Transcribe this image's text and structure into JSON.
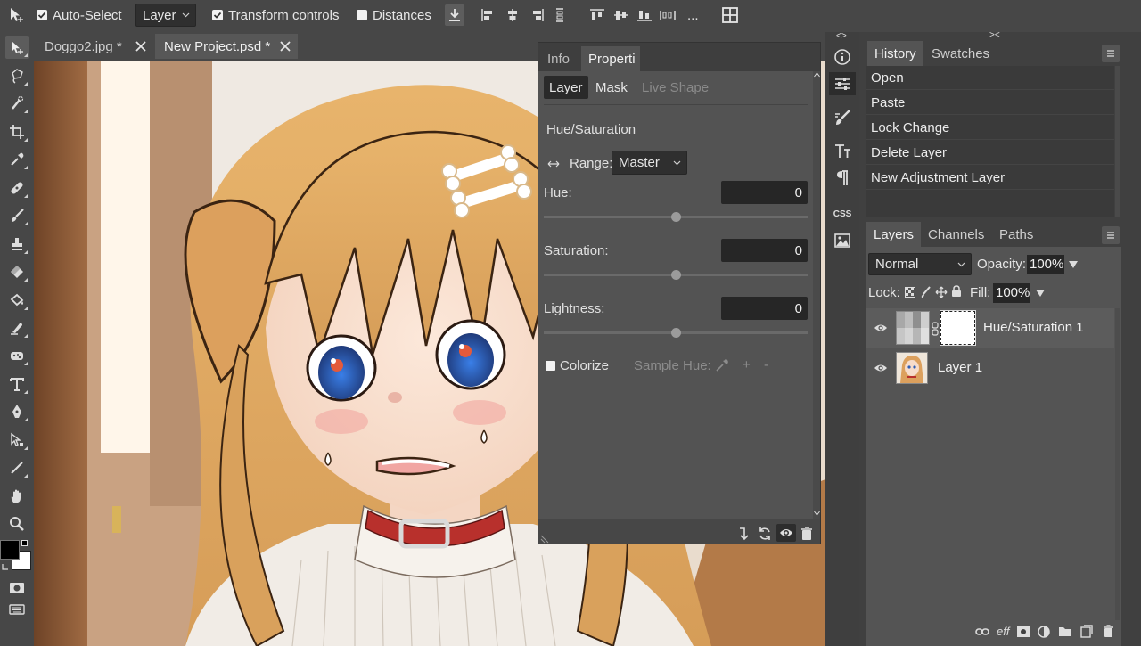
{
  "toolbar": {
    "auto_select_label": "Auto-Select",
    "auto_select_checked": true,
    "layer_select_value": "Layer",
    "transform_controls_label": "Transform controls",
    "transform_controls_checked": true,
    "distances_label": "Distances",
    "distances_checked": false,
    "more_label": "..."
  },
  "tabs": [
    {
      "label": "Doggo2.jpg *",
      "active": false
    },
    {
      "label": "New Project.psd *",
      "active": true
    }
  ],
  "properties": {
    "tabs": [
      {
        "label": "Info",
        "active": false
      },
      {
        "label": "Properti",
        "active": true
      }
    ],
    "subtabs": [
      {
        "label": "Layer",
        "active": true
      },
      {
        "label": "Mask",
        "active": false
      },
      {
        "label": "Live Shape",
        "active": false
      }
    ],
    "section_title": "Hue/Saturation",
    "range_label": "Range:",
    "range_value": "Master",
    "hue_label": "Hue:",
    "hue_value": "0",
    "saturation_label": "Saturation:",
    "saturation_value": "0",
    "lightness_label": "Lightness:",
    "lightness_value": "0",
    "colorize_label": "Colorize",
    "colorize_checked": false,
    "sample_hue_label": "Sample Hue:",
    "plus_label": "+",
    "minus_label": "-"
  },
  "midcol": {
    "css_label": "CSS",
    "icons": [
      "info-icon",
      "adjustments-icon",
      "brush-settings-icon",
      "character-icon",
      "paragraph-icon",
      "css-icon",
      "image-icon"
    ]
  },
  "history": {
    "tabs": [
      {
        "label": "History",
        "active": true
      },
      {
        "label": "Swatches",
        "active": false
      }
    ],
    "items": [
      "Open",
      "Paste",
      "Lock Change",
      "Delete Layer",
      "New Adjustment Layer"
    ]
  },
  "layers": {
    "tabs": [
      {
        "label": "Layers",
        "active": true
      },
      {
        "label": "Channels",
        "active": false
      },
      {
        "label": "Paths",
        "active": false
      }
    ],
    "blend_mode": "Normal",
    "opacity_label": "Opacity:",
    "opacity_value": "100%",
    "lock_label": "Lock:",
    "fill_label": "Fill:",
    "fill_value": "100%",
    "items": [
      {
        "name": "Hue/Saturation 1",
        "selected": true,
        "type": "adjustment"
      },
      {
        "name": "Layer 1",
        "selected": false,
        "type": "image"
      }
    ],
    "effects_label": "eff"
  },
  "colors": {
    "foreground": "#000000",
    "background": "#ffffff",
    "ui_dark": "#474747",
    "panel": "#3e3e3e"
  }
}
